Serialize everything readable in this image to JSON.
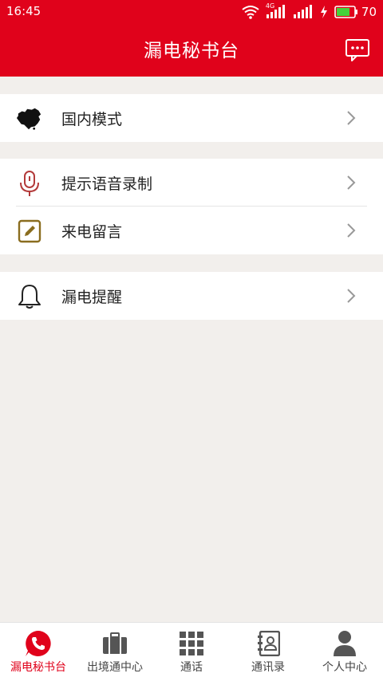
{
  "status_bar": {
    "time": "16:45",
    "battery": "70",
    "network_label": "4G"
  },
  "header": {
    "title": "漏电秘书台"
  },
  "groups": [
    {
      "items": [
        {
          "label": "国内模式",
          "icon": "china-map-icon"
        }
      ]
    },
    {
      "items": [
        {
          "label": "提示语音录制",
          "icon": "microphone-icon"
        },
        {
          "label": "来电留言",
          "icon": "edit-note-icon"
        }
      ]
    },
    {
      "items": [
        {
          "label": "漏电提醒",
          "icon": "bell-icon"
        }
      ]
    }
  ],
  "tabbar": {
    "items": [
      {
        "label": "漏电秘书台",
        "icon": "phone-bubble-icon",
        "active": true
      },
      {
        "label": "出境通中心",
        "icon": "briefcase-icon"
      },
      {
        "label": "通话",
        "icon": "dialpad-icon"
      },
      {
        "label": "通讯录",
        "icon": "contacts-book-icon"
      },
      {
        "label": "个人中心",
        "icon": "person-icon"
      }
    ]
  },
  "colors": {
    "brand": "#e0021b",
    "background": "#f2efec",
    "mic": "#b33a3a",
    "edit": "#8a6d1f"
  }
}
